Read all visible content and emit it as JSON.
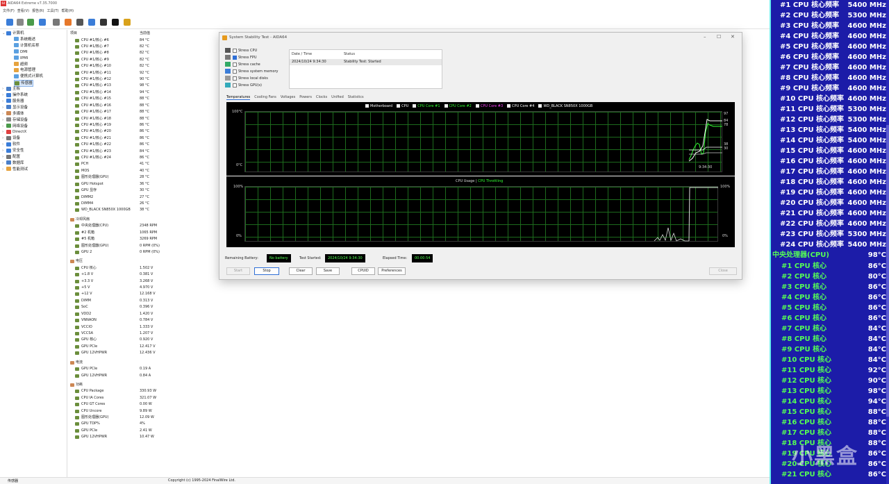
{
  "window": {
    "title": "AIDA64 Extreme v7.35.7000",
    "icon": "aida64-icon"
  },
  "menu": [
    "文件(F)",
    "查看(V)",
    "报告(R)",
    "工具(T)",
    "帮助(H)"
  ],
  "toolbar": {
    "icons": [
      "refresh-icon",
      "report-icon",
      "cpu-icon",
      "network-icon",
      "database-icon",
      "flame-icon",
      "disk-icon",
      "user-icon",
      "monitor-icon",
      "benchmark-icon",
      "sensor-icon"
    ]
  },
  "tree": [
    {
      "label": "计算机",
      "level": 0,
      "expanded": true
    },
    {
      "label": "系统概述",
      "level": 1
    },
    {
      "label": "计算机名称",
      "level": 1
    },
    {
      "label": "DMI",
      "level": 1
    },
    {
      "label": "IPMI",
      "level": 1
    },
    {
      "label": "超频",
      "level": 1
    },
    {
      "label": "电源管理",
      "level": 1
    },
    {
      "label": "便携式计算机",
      "level": 1
    },
    {
      "label": "传感器",
      "level": 1,
      "selected": true
    },
    {
      "label": "主板",
      "level": 0
    },
    {
      "label": "操作系统",
      "level": 0
    },
    {
      "label": "服务器",
      "level": 0
    },
    {
      "label": "显示设备",
      "level": 0
    },
    {
      "label": "多媒体",
      "level": 0
    },
    {
      "label": "存储设备",
      "level": 0
    },
    {
      "label": "网络设备",
      "level": 0
    },
    {
      "label": "DirectX",
      "level": 0
    },
    {
      "label": "设备",
      "level": 0
    },
    {
      "label": "软件",
      "level": 0
    },
    {
      "label": "安全性",
      "level": 0
    },
    {
      "label": "配置",
      "level": 0
    },
    {
      "label": "数据库",
      "level": 0
    },
    {
      "label": "性能测试",
      "level": 0
    }
  ],
  "list_header": {
    "item": "项目",
    "value": "当前值"
  },
  "temps": [
    [
      "CPU #1/核心 #6",
      "84 °C"
    ],
    [
      "CPU #1/核心 #7",
      "82 °C"
    ],
    [
      "CPU #1/核心 #8",
      "82 °C"
    ],
    [
      "CPU #1/核心 #9",
      "82 °C"
    ],
    [
      "CPU #1/核心 #10",
      "82 °C"
    ],
    [
      "CPU #1/核心 #11",
      "92 °C"
    ],
    [
      "CPU #1/核心 #12",
      "90 °C"
    ],
    [
      "CPU #1/核心 #13",
      "98 °C"
    ],
    [
      "CPU #1/核心 #14",
      "94 °C"
    ],
    [
      "CPU #1/核心 #15",
      "88 °C"
    ],
    [
      "CPU #1/核心 #16",
      "88 °C"
    ],
    [
      "CPU #1/核心 #17",
      "88 °C"
    ],
    [
      "CPU #1/核心 #18",
      "88 °C"
    ],
    [
      "CPU #1/核心 #19",
      "86 °C"
    ],
    [
      "CPU #1/核心 #20",
      "86 °C"
    ],
    [
      "CPU #1/核心 #21",
      "86 °C"
    ],
    [
      "CPU #1/核心 #22",
      "86 °C"
    ],
    [
      "CPU #1/核心 #23",
      "84 °C"
    ],
    [
      "CPU #1/核心 #24",
      "86 °C"
    ],
    [
      "PCH",
      "41 °C"
    ],
    [
      "MOS",
      "40 °C"
    ],
    [
      "图形处理器(GPU)",
      "28 °C"
    ],
    [
      "GPU Hotspot",
      "36 °C"
    ],
    [
      "GPU 显存",
      "30 °C"
    ],
    [
      "DIMM2",
      "27 °C"
    ],
    [
      "DIMM4",
      "26 °C"
    ],
    [
      "WD_BLACK SN850X 1000GB",
      "38 °C"
    ]
  ],
  "fans_header": "冷却风扇",
  "fans": [
    [
      "中央处理器(CPU)",
      "2348 RPM"
    ],
    [
      "#2 机箱",
      "1065 RPM"
    ],
    [
      "#5 机箱",
      "3269 RPM"
    ],
    [
      "图形处理器(GPU)",
      "0 RPM  (0%)"
    ],
    [
      "GPU 2",
      "0 RPM  (0%)"
    ]
  ],
  "volt_header": "电压",
  "volts": [
    [
      "CPU 核心",
      "1.502 V"
    ],
    [
      "+1.8 V",
      "0.381 V"
    ],
    [
      "+3.3 V",
      "3.268 V"
    ],
    [
      "+5 V",
      "4.970 V"
    ],
    [
      "+12 V",
      "12.168 V"
    ],
    [
      "DIMM",
      "0.313 V"
    ],
    [
      "SoC",
      "0.396 V"
    ],
    [
      "VDD2",
      "1.420 V"
    ],
    [
      "VNNAON",
      "0.784 V"
    ],
    [
      "VCCIO",
      "1.333 V"
    ],
    [
      "VCCSA",
      "1.207 V"
    ],
    [
      "GPU 核心",
      "0.920 V"
    ],
    [
      "GPU PCIe",
      "12.417 V"
    ],
    [
      "GPU 12VHPWR",
      "12.436 V"
    ]
  ],
  "curr_header": "电流",
  "currs": [
    [
      "GPU PCIe",
      "0.19 A"
    ],
    [
      "GPU 12VHPWR",
      "0.84 A"
    ]
  ],
  "power_header": "功耗",
  "powers": [
    [
      "CPU Package",
      "330.93 W"
    ],
    [
      "CPU IA Cores",
      "321.07 W"
    ],
    [
      "CPU GT Cores",
      "0.00 W"
    ],
    [
      "CPU Uncore",
      "9.89 W"
    ],
    [
      "图形处理器(GPU)",
      "12.09 W"
    ],
    [
      "GPU TDP%",
      "4%"
    ],
    [
      "GPU PCIe",
      "2.41 W"
    ],
    [
      "GPU 12VHPWR",
      "10.47 W"
    ]
  ],
  "statusbar": {
    "left": "传感器",
    "center": "Copyright (c) 1995-2024 FinalWire Ltd."
  },
  "dialog": {
    "title": "System Stability Test - AIDA64",
    "stress": [
      {
        "label": "Stress CPU",
        "checked": false
      },
      {
        "label": "Stress FPU",
        "checked": true
      },
      {
        "label": "Stress cache",
        "checked": false
      },
      {
        "label": "Stress system memory",
        "checked": false
      },
      {
        "label": "Stress local disks",
        "checked": false
      },
      {
        "label": "Stress GPU(s)",
        "checked": false
      }
    ],
    "log_headers": [
      "Date / Time",
      "Status"
    ],
    "log_rows": [
      [
        "2024/10/24 9:34:30",
        "Stability Test: Started"
      ]
    ],
    "tabs": [
      "Temperatures",
      "Cooling Fans",
      "Voltages",
      "Powers",
      "Clocks",
      "Unified",
      "Statistics"
    ],
    "temp_graph": {
      "legend": [
        {
          "name": "Motherboard",
          "color": "#ffffff"
        },
        {
          "name": "CPU",
          "color": "#ffffff"
        },
        {
          "name": "CPU Core #1",
          "color": "#33ff33"
        },
        {
          "name": "CPU Core #2",
          "color": "#33ff33"
        },
        {
          "name": "CPU Core #3",
          "color": "#ff44ff"
        },
        {
          "name": "CPU Core #4",
          "color": "#ffffff"
        },
        {
          "name": "WD_BLACK SN850X 1000GB",
          "color": "#ffffff"
        }
      ],
      "ytop": "100°C",
      "ybottom": "0°C",
      "time": "9:34:30",
      "right_labels": [
        "97",
        "84",
        "78",
        "38",
        "30"
      ]
    },
    "usage_graph": {
      "legend_a": "CPU Usage",
      "legend_sep": "|",
      "legend_b": "CPU Throttling",
      "ytop": "100%",
      "ybottom": "0%",
      "ytop_right": "100%",
      "ybottom_right": "0%"
    },
    "battery_label": "Remaining Battery:",
    "battery_value": "No battery",
    "started_label": "Test Started:",
    "started_value": "2024/10/24 9:34:30",
    "elapsed_label": "Elapsed Time:",
    "elapsed_value": "00:00:54",
    "buttons": {
      "start": "Start",
      "stop": "Stop",
      "clear": "Clear",
      "save": "Save",
      "cpuid": "CPUID",
      "prefs": "Preferences",
      "close": "Close"
    }
  },
  "osd": {
    "freq": [
      [
        "#1 CPU 核心频率",
        "5400 MHz"
      ],
      [
        "#2 CPU 核心频率",
        "5300 MHz"
      ],
      [
        "#3 CPU 核心频率",
        "4600 MHz"
      ],
      [
        "#4 CPU 核心频率",
        "4600 MHz"
      ],
      [
        "#5 CPU 核心频率",
        "4600 MHz"
      ],
      [
        "#6 CPU 核心频率",
        "4600 MHz"
      ],
      [
        "#7 CPU 核心频率",
        "4600 MHz"
      ],
      [
        "#8 CPU 核心频率",
        "4600 MHz"
      ],
      [
        "#9 CPU 核心频率",
        "4600 MHz"
      ],
      [
        "#10 CPU 核心频率",
        "4600 MHz"
      ],
      [
        "#11 CPU 核心频率",
        "5300 MHz"
      ],
      [
        "#12 CPU 核心频率",
        "5300 MHz"
      ],
      [
        "#13 CPU 核心频率",
        "5400 MHz"
      ],
      [
        "#14 CPU 核心频率",
        "5400 MHz"
      ],
      [
        "#15 CPU 核心频率",
        "4600 MHz"
      ],
      [
        "#16 CPU 核心频率",
        "4600 MHz"
      ],
      [
        "#17 CPU 核心频率",
        "4600 MHz"
      ],
      [
        "#18 CPU 核心频率",
        "4600 MHz"
      ],
      [
        "#19 CPU 核心频率",
        "4600 MHz"
      ],
      [
        "#20 CPU 核心频率",
        "4600 MHz"
      ],
      [
        "#21 CPU 核心频率",
        "4600 MHz"
      ],
      [
        "#22 CPU 核心频率",
        "4600 MHz"
      ],
      [
        "#23 CPU 核心频率",
        "5300 MHz"
      ],
      [
        "#24 CPU 核心频率",
        "5400 MHz"
      ]
    ],
    "cpu_temp": [
      "中央处理器(CPU)",
      "98°C"
    ],
    "temps": [
      [
        "#1 CPU 核心",
        "86°C"
      ],
      [
        "#2 CPU 核心",
        "80°C"
      ],
      [
        "#3 CPU 核心",
        "86°C"
      ],
      [
        "#4 CPU 核心",
        "86°C"
      ],
      [
        "#5 CPU 核心",
        "86°C"
      ],
      [
        "#6 CPU 核心",
        "86°C"
      ],
      [
        "#7 CPU 核心",
        "84°C"
      ],
      [
        "#8 CPU 核心",
        "84°C"
      ],
      [
        "#9 CPU 核心",
        "84°C"
      ],
      [
        "#10 CPU 核心",
        "84°C"
      ],
      [
        "#11 CPU 核心",
        "92°C"
      ],
      [
        "#12 CPU 核心",
        "90°C"
      ],
      [
        "#13 CPU 核心",
        "98°C"
      ],
      [
        "#14 CPU 核心",
        "94°C"
      ],
      [
        "#15 CPU 核心",
        "88°C"
      ],
      [
        "#16 CPU 核心",
        "88°C"
      ],
      [
        "#17 CPU 核心",
        "88°C"
      ],
      [
        "#18 CPU 核心",
        "88°C"
      ],
      [
        "#19 CPU 核心",
        "86°C"
      ],
      [
        "#20 CPU 核心",
        "86°C"
      ],
      [
        "#21 CPU 核心",
        "86°C"
      ]
    ],
    "watermark": "小黑盒"
  },
  "colors": {
    "osd_bg": "#1c1ca8",
    "osd_green": "#55ff55",
    "graph_grid": "#1d6b1d",
    "accent": "#2f6fd6"
  }
}
